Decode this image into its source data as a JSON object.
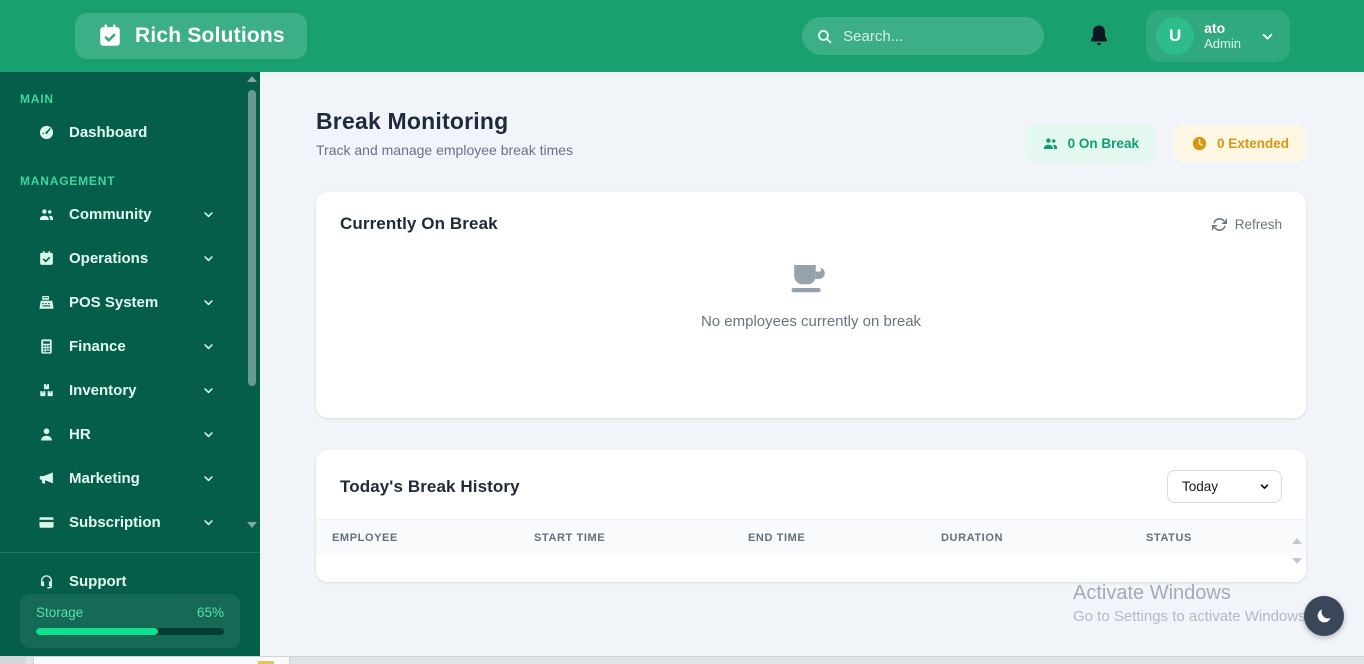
{
  "topbar": {
    "brand": "Rich Solutions",
    "search_placeholder": "Search...",
    "user": {
      "initial": "U",
      "name": "ato",
      "role": "Admin"
    }
  },
  "sidebar": {
    "sections": [
      {
        "label": "MAIN",
        "items": [
          {
            "label": "Dashboard",
            "icon": "dashboard-gauge-icon"
          }
        ]
      },
      {
        "label": "MANAGEMENT",
        "items": [
          {
            "label": "Community",
            "icon": "users-icon"
          },
          {
            "label": "Operations",
            "icon": "calendar-check-icon"
          },
          {
            "label": "POS System",
            "icon": "cash-register-icon"
          },
          {
            "label": "Finance",
            "icon": "calculator-icon"
          },
          {
            "label": "Inventory",
            "icon": "boxes-icon"
          },
          {
            "label": "HR",
            "icon": "person-icon"
          },
          {
            "label": "Marketing",
            "icon": "megaphone-icon"
          },
          {
            "label": "Subscription",
            "icon": "credit-card-icon"
          }
        ]
      }
    ],
    "support_label": "Support",
    "storage": {
      "label": "Storage",
      "percent": "65%",
      "value": 65
    }
  },
  "main": {
    "title": "Break Monitoring",
    "subtitle": "Track and manage employee break times",
    "badges": {
      "on_break": "0 On Break",
      "extended": "0 Extended"
    },
    "current_card": {
      "title": "Currently On Break",
      "refresh_label": "Refresh",
      "empty_text": "No employees currently on break"
    },
    "history_card": {
      "title": "Today's Break History",
      "filter_value": "Today",
      "columns": [
        "EMPLOYEE",
        "START TIME",
        "END TIME",
        "DURATION",
        "STATUS"
      ],
      "rows": []
    }
  },
  "watermark": {
    "line1": "Activate Windows",
    "line2": "Go to Settings to activate Windows"
  },
  "colors": {
    "navbar_green": "#18A06F",
    "sidebar_green": "#055E49",
    "accent_green": "#0EE08F",
    "on_break_badge_bg": "#E3F8EF",
    "on_break_badge_text": "#0E9E74",
    "extended_badge_bg": "#FDF7E3",
    "extended_badge_text": "#D9970F",
    "moon_button_bg": "#3A4759"
  }
}
